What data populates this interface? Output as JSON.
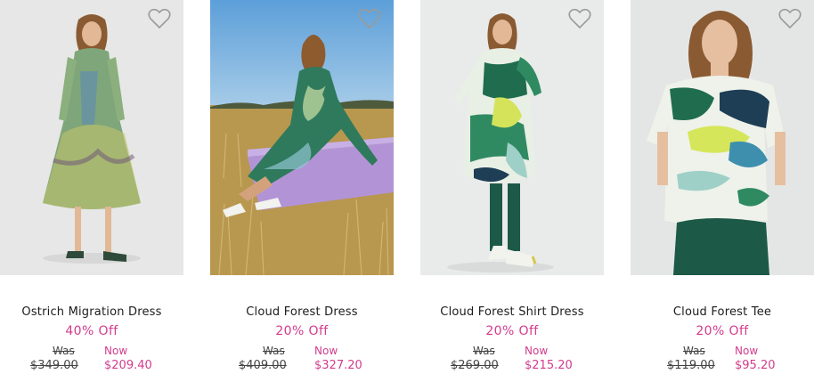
{
  "colors": {
    "sale_accent": "#d23c8c",
    "text": "#1c1c1c",
    "icon": "#9a9a9a"
  },
  "products": [
    {
      "title": "Ostrich Migration Dress",
      "discount": "40% Off",
      "was_label": "Was",
      "was_price": "$349.00",
      "now_label": "Now",
      "now_price": "$209.40",
      "wishlist_icon": "heart-outline-icon"
    },
    {
      "title": "Cloud Forest Dress",
      "discount": "20% Off",
      "was_label": "Was",
      "was_price": "$409.00",
      "now_label": "Now",
      "now_price": "$327.20",
      "wishlist_icon": "heart-outline-icon"
    },
    {
      "title": "Cloud Forest Shirt Dress",
      "discount": "20% Off",
      "was_label": "Was",
      "was_price": "$269.00",
      "now_label": "Now",
      "now_price": "$215.20",
      "wishlist_icon": "heart-outline-icon"
    },
    {
      "title": "Cloud Forest Tee",
      "discount": "20% Off",
      "was_label": "Was",
      "was_price": "$119.00",
      "now_label": "Now",
      "now_price": "$95.20",
      "wishlist_icon": "heart-outline-icon"
    }
  ]
}
